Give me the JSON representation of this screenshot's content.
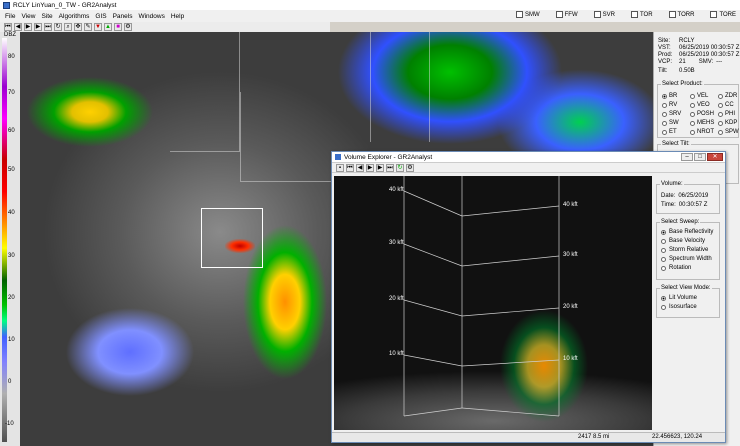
{
  "window": {
    "title": "RCLY LinYuan_0_TW - GR2Analyst"
  },
  "menu": [
    "File",
    "View",
    "Site",
    "Algorithms",
    "GIS",
    "Panels",
    "Windows",
    "Help"
  ],
  "warning_checks": [
    "SMW",
    "FFW",
    "SVR",
    "TOR",
    "TORR",
    "TORE"
  ],
  "scale": {
    "unit": "DBZ",
    "ticks": [
      "80",
      "70",
      "60",
      "50",
      "40",
      "30",
      "20",
      "10",
      "0",
      "-10"
    ]
  },
  "site_info": {
    "site_label": "Site:",
    "site": "RCLY",
    "vst_label": "VST:",
    "vst": "06/25/2019 00:30:57 Z",
    "prod_label": "Prod:",
    "prod": "06/25/2019 00:30:57 Z",
    "vcp_label": "VCP:",
    "vcp": "21",
    "smv_label": "SMV:",
    "smv": "---",
    "tilt_label": "Tilt:",
    "tilt": "0.50B"
  },
  "select_product": {
    "title": "Select Product:",
    "items": [
      "BR",
      "VEL",
      "ZDR",
      "RV",
      "VEO",
      "CC",
      "SRV",
      "POSH",
      "PHI",
      "SW",
      "MEHS",
      "KDP",
      "ET",
      "NROT",
      "SPW"
    ],
    "selected": "BR"
  },
  "select_tilt": {
    "title": "Select Tilt:"
  },
  "volume_explorer": {
    "title": "Volume Explorer - GR2Analyst",
    "height_labels_left": [
      "40 kft",
      "30 kft",
      "20 kft",
      "10 kft"
    ],
    "height_labels_right": [
      "40 kft",
      "30 kft",
      "20 kft",
      "10 kft"
    ],
    "volume": {
      "title": "Volume:",
      "date_label": "Date:",
      "date": "06/25/2019",
      "time_label": "Time:",
      "time": "00:30:57 Z"
    },
    "sweep": {
      "title": "Select Sweep:",
      "options": [
        "Base Reflectivity",
        "Base Velocity",
        "Storm Relative",
        "Spectrum Width",
        "Rotation"
      ],
      "selected": "Base Reflectivity"
    },
    "view_mode": {
      "title": "Select View Mode:",
      "options": [
        "Lit Volume",
        "Isosurface"
      ],
      "selected": "Lit Volume"
    },
    "status": {
      "distance": "2417 8.5 mi",
      "coords": "22.456623, 120.24"
    }
  }
}
